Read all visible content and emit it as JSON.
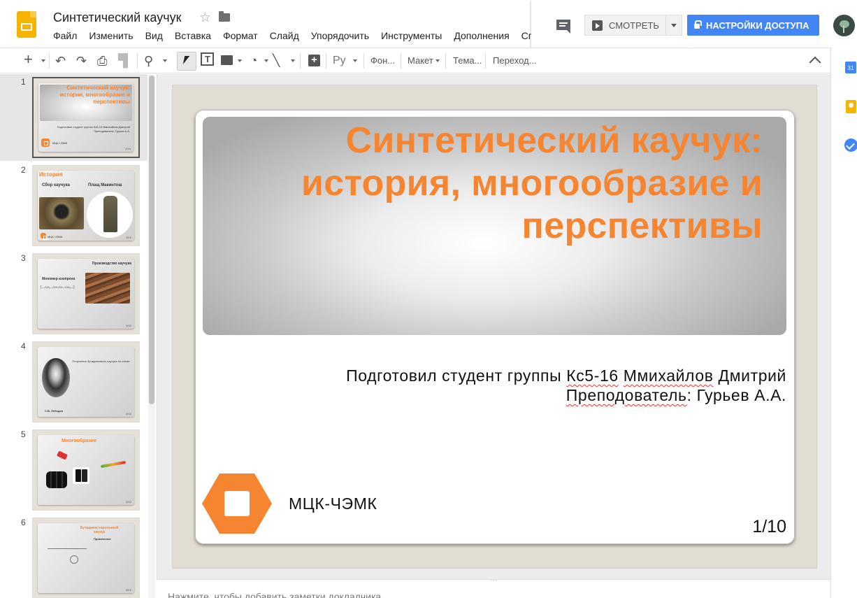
{
  "app": {
    "doc_title": "Синтетический каучук",
    "menu": [
      "Файл",
      "Изменить",
      "Вид",
      "Вставка",
      "Формат",
      "Слайд",
      "Упорядочить",
      "Инструменты",
      "Дополнения",
      "Сп"
    ],
    "watch_label": "СМОТРЕТЬ",
    "share_label": "НАСТРОЙКИ ДОСТУПА"
  },
  "toolbar": {
    "lang": "Ру",
    "background": "Фон...",
    "layout": "Макет",
    "theme": "Тема...",
    "transition": "Переход..."
  },
  "filmstrip": {
    "slides": [
      {
        "num": "1",
        "title": "Синтетический каучук: история, многообразие и перспективы",
        "text": "Подготовил студент группы Кс5-16 Ммихайлов Дмитрий Преподователь: Гурьев А.А.",
        "org": "МЦК-ЧЭМК",
        "page": "1/10"
      },
      {
        "num": "2",
        "title": "История",
        "cap1": "Сбор каучука",
        "cap2": "Плащ Макинтош",
        "org": "МЦК-ЧЭМК",
        "page": "2/10"
      },
      {
        "num": "3",
        "title": "Производство каучука",
        "cap1": "Мономер изопрена",
        "formula": "⎡—CH₂—CH=CH—CH₂—⎤",
        "page": "3/10"
      },
      {
        "num": "4",
        "cap1": "С.В. Лебедев",
        "cap2": "Получение бутадиенового каучука по схеме:",
        "page": "4/10"
      },
      {
        "num": "5",
        "title": "Многообразие",
        "page": "5/10"
      },
      {
        "num": "6",
        "title": "Бутадиенстирольный каучук",
        "cap1": "Применение",
        "page": "6/10"
      }
    ]
  },
  "slide": {
    "title": "Синтетический каучук: история, многообразие и перспективы",
    "subtitle_line1_pre": "Подготовил студент группы ",
    "subtitle_line1_w1": "Кс5-16",
    "subtitle_line1_mid": " ",
    "subtitle_line1_w2": "Ммихайлов",
    "subtitle_line1_post": " Дмитрий",
    "subtitle_line2_w1": "Преподователь",
    "subtitle_line2_post": ": Гурьев А.А.",
    "org": "МЦК-ЧЭМК",
    "page": "1/10"
  },
  "notes": {
    "placeholder": "Нажмите, чтобы добавить заметки докладчика"
  },
  "colors": {
    "accent": "#f58531",
    "share": "#4285f4",
    "docs_yellow": "#f4b400"
  }
}
